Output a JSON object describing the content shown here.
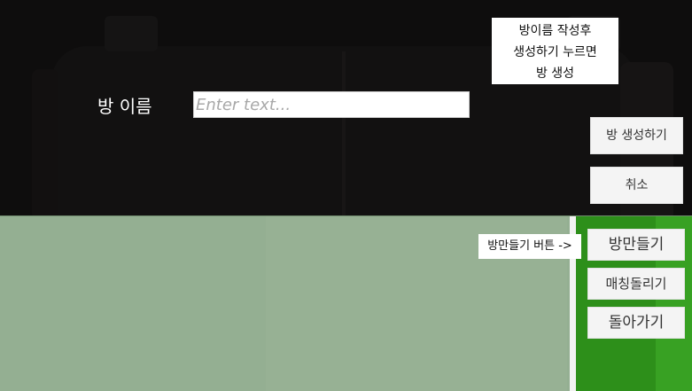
{
  "create_panel": {
    "room_name_label": "방 이름",
    "room_name_input": {
      "value": "",
      "placeholder": "Enter text..."
    },
    "hint_lines": [
      "방이름 작성후",
      "생성하기 누르면",
      "방 생성"
    ],
    "create_button_label": "방 생성하기",
    "cancel_button_label": "취소"
  },
  "lobby": {
    "arrow_label": "방만들기 버튼 ->",
    "make_room_button_label": "방만들기",
    "matching_button_label": "매칭돌리기",
    "back_button_label": "돌아가기"
  },
  "colors": {
    "background": "#0d0c0c",
    "room_list": "#94af92",
    "right_panel": "#2d8f1a",
    "button": "#f4f4f4"
  }
}
